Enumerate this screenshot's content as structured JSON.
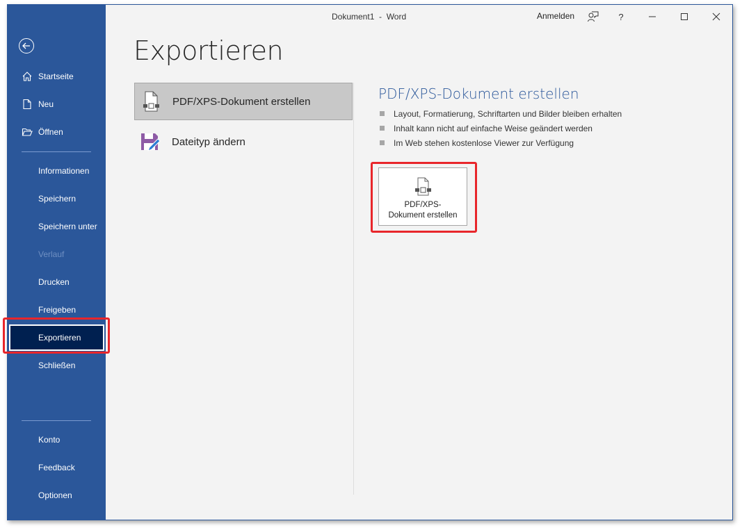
{
  "window": {
    "title": "Dokument1  -  Word",
    "sign_in": "Anmelden",
    "controls": {
      "feedback_icon": "person-feedback-icon",
      "help_label": "?",
      "minimize_icon": "minimize-icon",
      "maximize_icon": "maximize-icon",
      "close_icon": "close-icon"
    }
  },
  "sidebar": {
    "back_icon": "back-arrow-icon",
    "items": [
      {
        "label": "Startseite",
        "icon": "home-icon"
      },
      {
        "label": "Neu",
        "icon": "new-document-icon"
      },
      {
        "label": "Öffnen",
        "icon": "open-folder-icon"
      },
      {
        "label": "Informationen"
      },
      {
        "label": "Speichern"
      },
      {
        "label": "Speichern unter"
      },
      {
        "label": "Verlauf",
        "disabled": true
      },
      {
        "label": "Drucken"
      },
      {
        "label": "Freigeben"
      },
      {
        "label": "Exportieren",
        "active": true
      },
      {
        "label": "Schließen"
      },
      {
        "label": "Konto"
      },
      {
        "label": "Feedback"
      },
      {
        "label": "Optionen"
      }
    ]
  },
  "main": {
    "title": "Exportieren",
    "options": [
      {
        "label": "PDF/XPS-Dokument erstellen",
        "icon": "pdf-document-icon",
        "selected": true
      },
      {
        "label": "Dateityp ändern",
        "icon": "save-as-filetype-icon",
        "selected": false
      }
    ],
    "detail": {
      "title": "PDF/XPS-Dokument erstellen",
      "bullets": [
        "Layout, Formatierung, Schriftarten und Bilder bleiben erhalten",
        "Inhalt kann nicht auf einfache Weise geändert werden",
        "Im Web stehen kostenlose Viewer zur Verfügung"
      ],
      "button_line1": "PDF/XPS-",
      "button_line2": "Dokument erstellen"
    }
  },
  "colors": {
    "sidebar_bg": "#2b579a",
    "sidebar_active_bg": "#002050",
    "accent_title": "#2b579a",
    "highlight": "#e8262b"
  }
}
